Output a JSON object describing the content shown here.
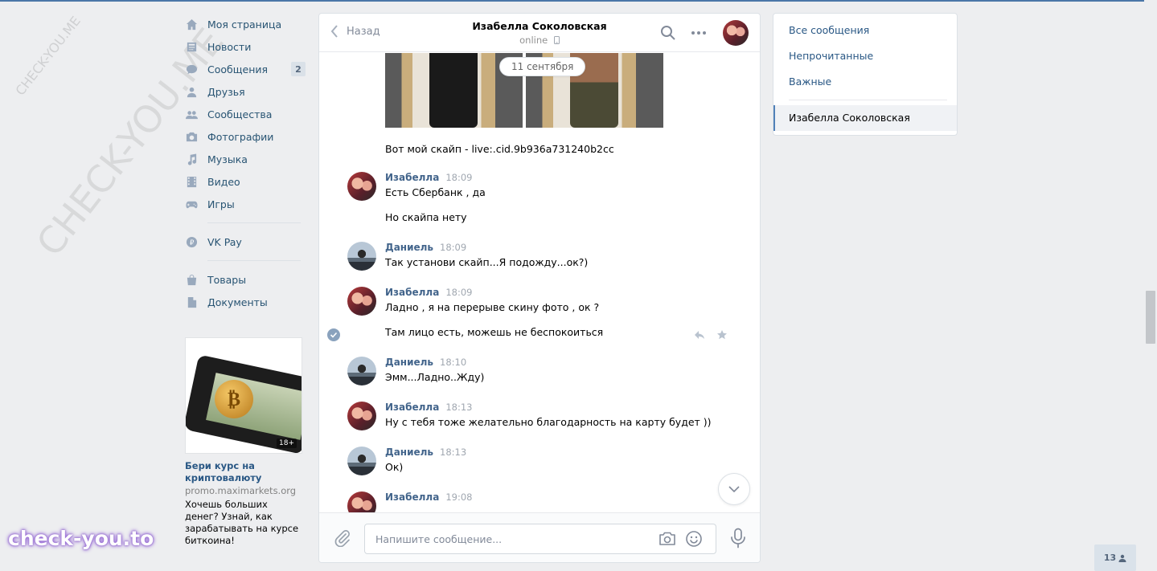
{
  "watermark": {
    "big": "CHECK-YOU.ME",
    "small": "CHECK-YOU.ME",
    "brand": "check-you.to"
  },
  "nav": {
    "items": [
      {
        "label": "Моя страница",
        "icon": "home-icon"
      },
      {
        "label": "Новости",
        "icon": "news-icon"
      },
      {
        "label": "Сообщения",
        "icon": "messages-icon",
        "badge": "2"
      },
      {
        "label": "Друзья",
        "icon": "friends-icon"
      },
      {
        "label": "Сообщества",
        "icon": "groups-icon"
      },
      {
        "label": "Фотографии",
        "icon": "camera-icon"
      },
      {
        "label": "Музыка",
        "icon": "music-icon"
      },
      {
        "label": "Видео",
        "icon": "video-icon"
      },
      {
        "label": "Игры",
        "icon": "games-icon"
      }
    ],
    "pay": {
      "label": "VK Pay",
      "icon": "vkpay-icon"
    },
    "extra": [
      {
        "label": "Товары",
        "icon": "shop-icon"
      },
      {
        "label": "Документы",
        "icon": "document-icon"
      }
    ]
  },
  "ad": {
    "age": "18+",
    "title": "Бери курс на криптовалюту",
    "domain": "promo.maximarkets.org",
    "text": "Хочешь больших денег? Узнай, как зарабатывать на курсе биткоина!"
  },
  "chat": {
    "back": "Назад",
    "peer_name": "Изабелла Соколовская",
    "peer_status": "online",
    "date_pill": "11 сентября",
    "skype_line": "Вот мой скайп - live:.cid.9b936a731240b2cc",
    "messages": [
      {
        "sender": "Изабелла",
        "time": "18:09",
        "lines": [
          "Есть Сбербанк , да",
          "Но скайпа нету"
        ]
      },
      {
        "sender": "Даниель",
        "time": "18:09",
        "lines": [
          "Так установи скайп...Я подожду...ок?)"
        ]
      },
      {
        "sender": "Изабелла",
        "time": "18:09",
        "lines": [
          "Ладно , я на перерыве скину фото , ок ?",
          "Там лицо есть, можешь не беспокоиться"
        ]
      },
      {
        "sender": "Даниель",
        "time": "18:10",
        "lines": [
          "Эмм...Ладно..Жду)"
        ]
      },
      {
        "sender": "Изабелла",
        "time": "18:13",
        "lines": [
          "Ну с тебя тоже желательно благодарность на карту будет ))"
        ]
      },
      {
        "sender": "Даниель",
        "time": "18:13",
        "lines": [
          "Ок)"
        ]
      },
      {
        "sender": "Изабелла",
        "time": "19:08",
        "lines": []
      }
    ],
    "composer_placeholder": "Напишите сообщение..."
  },
  "right_panel": {
    "items": [
      "Все сообщения",
      "Непрочитанные",
      "Важные"
    ],
    "active": "Изабелла Соколовская"
  },
  "corner_counter": "13",
  "colors": {
    "accent": "#4a76a8",
    "link": "#2a5885",
    "sender": "#42648b",
    "bg": "#edeef0"
  }
}
